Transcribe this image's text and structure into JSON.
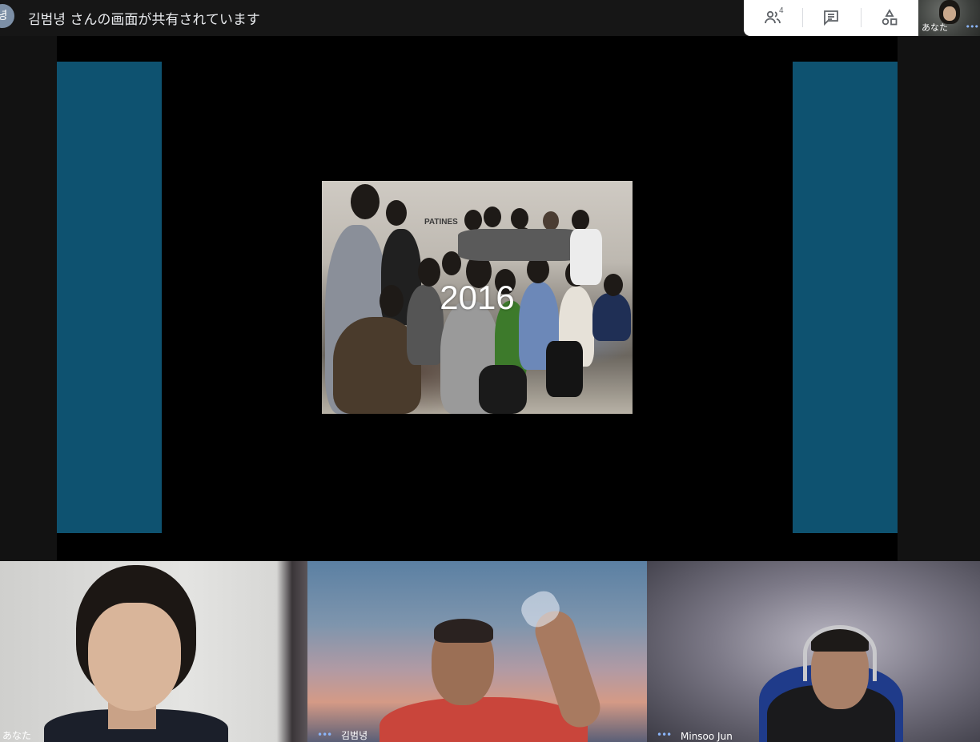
{
  "topbar": {
    "presenter_initial": "녕",
    "share_title": "김범녕 さんの画面が共有されています",
    "people_count": "4",
    "icons": {
      "people": "people-icon",
      "chat": "chat-icon",
      "activities": "shapes-icon"
    },
    "self_preview_label": "あなた"
  },
  "slide": {
    "year": "2016",
    "sign_text": "PATINES"
  },
  "participants": [
    {
      "name": "あなた"
    },
    {
      "name": "김범녕"
    },
    {
      "name": "Minsoo Jun"
    }
  ],
  "colors": {
    "side_panel": "#0e5270",
    "controls_bg": "#ffffff",
    "dots_accent": "#8ab4f8"
  }
}
